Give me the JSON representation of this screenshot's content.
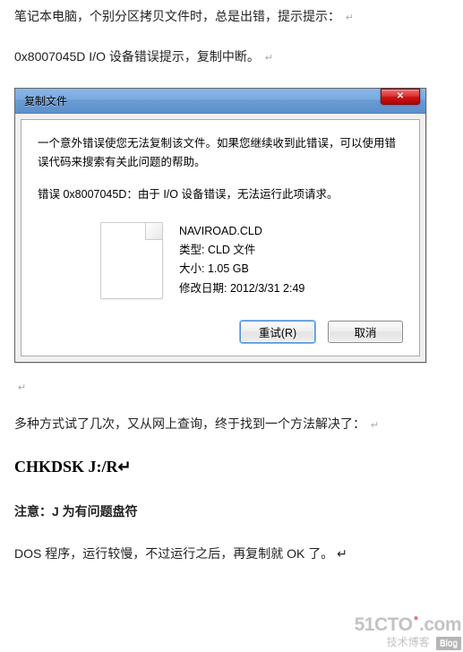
{
  "article": {
    "intro": "笔记本电脑，个别分区拷贝文件时，总是出错，提示提示：",
    "error_line": "0x8007045D I/O 设备错误提示，复制中断。",
    "method_found": "多种方式试了几次，又从网上查询，终于找到一个方法解决了：",
    "command": "CHKDSK J:/R",
    "note_label": "注意：",
    "note_text": "J 为有问题盘符",
    "closing": "DOS 程序，运行较慢，不过运行之后，再复制就 OK 了。"
  },
  "dialog": {
    "title": "复制文件",
    "message": "一个意外错误使您无法复制该文件。如果您继续收到此错误，可以使用错误代码来搜索有关此问题的帮助。",
    "error": "错误 0x8007045D：由于 I/O 设备错误，无法运行此项请求。",
    "file": {
      "name": "NAVIROAD.CLD",
      "type_label": "类型: CLD 文件",
      "size_label": "大小: 1.05 GB",
      "modified_label": "修改日期: 2012/3/31 2:49"
    },
    "buttons": {
      "retry": "重试(R)",
      "cancel": "取消"
    }
  },
  "watermark": {
    "brand": "51CTO",
    "tld": ".com",
    "tagline": "技术博客",
    "badge": "Blog"
  },
  "glyphs": {
    "nl": "↵"
  }
}
